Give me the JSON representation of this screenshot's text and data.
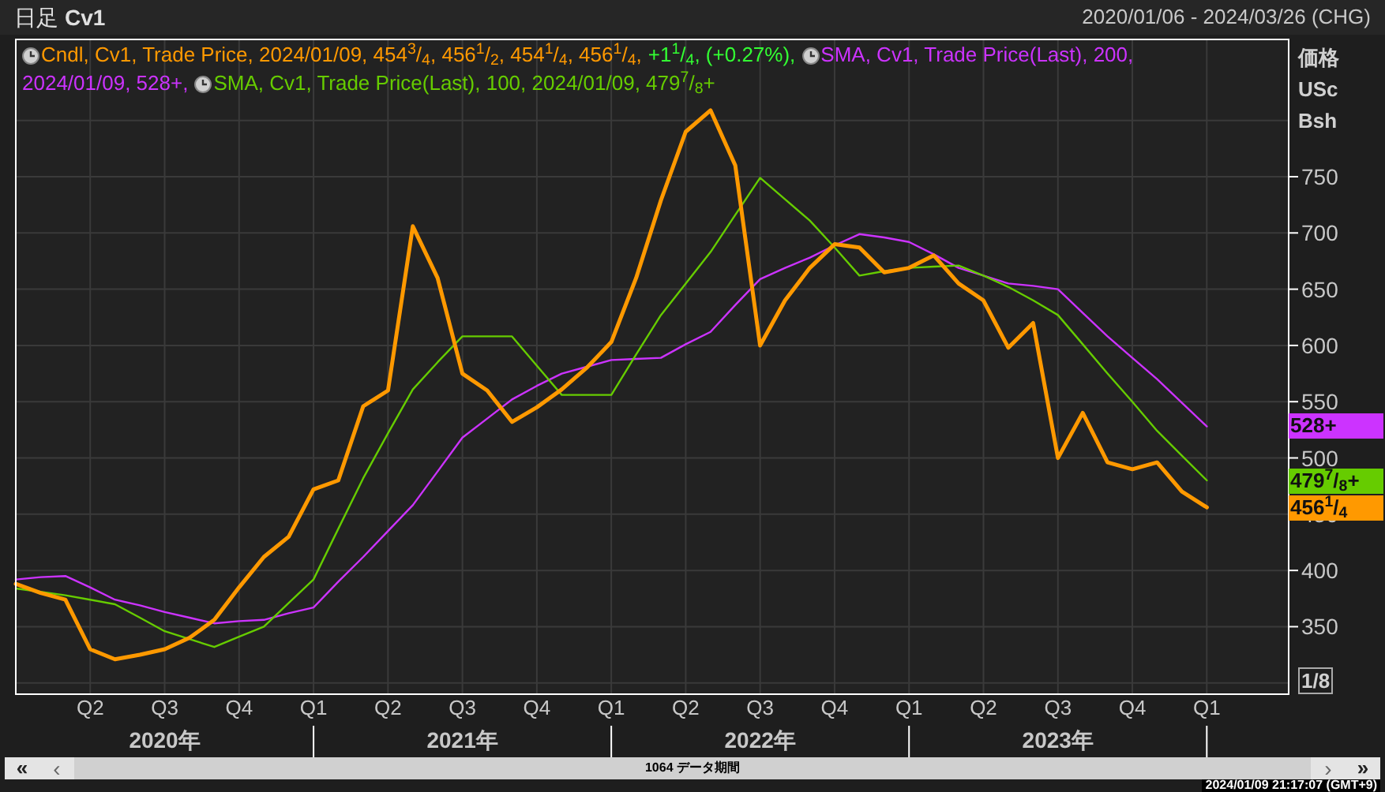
{
  "title": {
    "period": "日足",
    "symbol": "Cv1",
    "range": "2020/01/06 - 2024/03/26 (CHG)"
  },
  "legend": [
    [
      {
        "icon": true,
        "color": "#ff9900",
        "text": "Cndl, Cv1, Trade Price, 2024/01/09, 454$^{3}$/$_{4}$, 456$^{1}$/$_{2}$, 454$^{1}$/$_{4}$, 456$^{1}$/$_{4}$,"
      },
      {
        "icon": false,
        "color": "#33ff33",
        "text": "+1$^{1}$/$_{4}$, (+0.27%),"
      },
      {
        "icon": true,
        "color": "#cc33ff",
        "text": "SMA, Cv1, Trade Price(Last),  200,"
      }
    ],
    [
      {
        "icon": false,
        "color": "#cc33ff",
        "text": "2024/01/09, 528+,"
      },
      {
        "icon": true,
        "color": "#66cc00",
        "text": "SMA, Cv1, Trade Price(Last),  100, 2024/01/09, 479$^{7}$/$_{8}$+"
      }
    ]
  ],
  "axis_labels": [
    "価格",
    "USc",
    "Bsh"
  ],
  "fraction_label": "1/8",
  "chart_data": {
    "type": "line",
    "categories": [
      null,
      null,
      null,
      "Q2",
      null,
      null,
      "Q3",
      null,
      null,
      "Q4",
      null,
      null,
      "Q1",
      null,
      null,
      "Q2",
      null,
      null,
      "Q3",
      null,
      null,
      "Q4",
      null,
      null,
      "Q1",
      null,
      null,
      "Q2",
      null,
      null,
      "Q3",
      null,
      null,
      "Q4",
      null,
      null,
      "Q1",
      null,
      null,
      "Q2",
      null,
      null,
      "Q3",
      null,
      null,
      "Q4",
      null,
      null,
      "Q1"
    ],
    "series": [
      {
        "color": "#cc33ff",
        "values": [
          392,
          394,
          395,
          385,
          374,
          369,
          363,
          358,
          353,
          355,
          356,
          362,
          367,
          390,
          412,
          435,
          458,
          488,
          518,
          535,
          552,
          564,
          575,
          581,
          587,
          588,
          589,
          601,
          612,
          636,
          659,
          669,
          678,
          689,
          699,
          696,
          692,
          681,
          669,
          662,
          655,
          653,
          650,
          629,
          608,
          589,
          570,
          549,
          528
        ]
      },
      {
        "color": "#66cc00",
        "values": [
          384,
          381,
          378,
          374,
          370,
          358,
          346,
          339,
          332,
          341,
          350,
          371,
          392,
          437,
          482,
          522,
          561,
          585,
          608,
          608,
          608,
          582,
          556,
          556,
          556,
          592,
          627,
          655,
          683,
          716,
          749,
          730,
          711,
          687,
          662,
          666,
          669,
          670,
          671,
          662,
          652,
          640,
          627,
          601,
          575,
          550,
          524,
          502,
          480
        ]
      },
      {
        "color": "#ff9900",
        "values": [
          388,
          380,
          374,
          330,
          321,
          325,
          330,
          340,
          356,
          385,
          412,
          430,
          472,
          480,
          546,
          560,
          706,
          660,
          575,
          560,
          532,
          545,
          561,
          580,
          603,
          660,
          729,
          790,
          809,
          760,
          600,
          640,
          669,
          690,
          687,
          665,
          669,
          680,
          655,
          640,
          598,
          620,
          500,
          540,
          496,
          490,
          496,
          470,
          456
        ]
      }
    ],
    "grid": true,
    "ylim": [
      290,
      872
    ],
    "yticks": [
      350,
      400,
      450,
      500,
      550,
      600,
      650,
      700,
      750
    ]
  },
  "year_labels": [
    "2020年",
    "2021年",
    "2022年",
    "2023年"
  ],
  "price_tags": [
    {
      "text": "528+",
      "color": "#cc33ff"
    },
    {
      "text": "479$^{7}$/$_{8}$+",
      "color": "#66cc00"
    },
    {
      "text": "456$^{1}$/$_{4}$",
      "color": "#ff9900"
    }
  ],
  "scrollbar": {
    "first": "«",
    "prev": "‹",
    "label": "1064 データ期間",
    "next": "›",
    "last": "»"
  },
  "status": "2024/01/09 21:17:07 (GMT+9)"
}
